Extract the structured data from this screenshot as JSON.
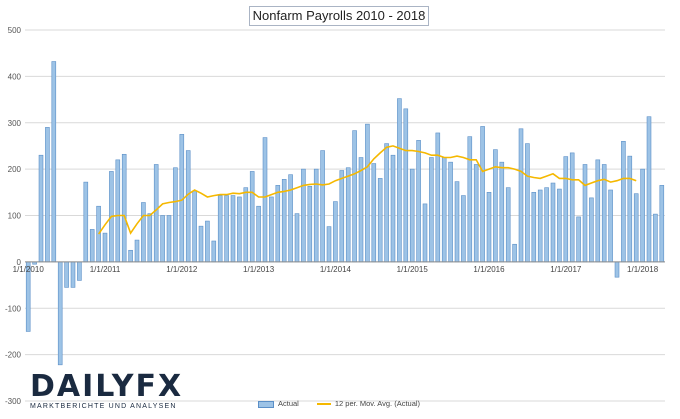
{
  "chart_data": {
    "type": "bar",
    "title": "Nonfarm Payrolls 2010 - 2018",
    "ylim": [
      -300,
      500
    ],
    "yticks": [
      500,
      400,
      300,
      200,
      100,
      0,
      -100,
      -200,
      -300
    ],
    "xtick_labels": [
      {
        "label": "1/1/2010",
        "index": 0
      },
      {
        "label": "1/1/2011",
        "index": 12
      },
      {
        "label": "1/1/2012",
        "index": 24
      },
      {
        "label": "1/1/2013",
        "index": 36
      },
      {
        "label": "1/1/2014",
        "index": 48
      },
      {
        "label": "1/1/2015",
        "index": 60
      },
      {
        "label": "1/1/2016",
        "index": 72
      },
      {
        "label": "1/1/2017",
        "index": 84
      },
      {
        "label": "1/1/2018",
        "index": 96
      }
    ],
    "grid": true,
    "legend_placement": "bottom",
    "series": [
      {
        "name": "Actual",
        "kind": "bar",
        "color": "#9dc3e6",
        "values": [
          -150,
          -5,
          230,
          290,
          432,
          -222,
          -55,
          -55,
          -40,
          172,
          70,
          120,
          62,
          195,
          220,
          232,
          25,
          47,
          128,
          104,
          210,
          100,
          100,
          203,
          275,
          240,
          153,
          77,
          88,
          45,
          143,
          143,
          143,
          140,
          160,
          195,
          120,
          268,
          140,
          165,
          178,
          188,
          104,
          200,
          163,
          200,
          240,
          76,
          130,
          197,
          203,
          283,
          225,
          297,
          212,
          180,
          255,
          230,
          352,
          330,
          200,
          262,
          125,
          225,
          278,
          225,
          215,
          173,
          143,
          270,
          210,
          292,
          150,
          242,
          215,
          160,
          38,
          287,
          255,
          150,
          155,
          160,
          170,
          157,
          227,
          235,
          97,
          210,
          138,
          220,
          210,
          155,
          -33,
          260,
          228,
          147,
          200,
          313,
          103,
          165
        ]
      },
      {
        "name": "12 per. Mov. Avg. (Actual)",
        "kind": "line",
        "color": "#f5b800",
        "start_index": 11,
        "values": [
          60,
          80,
          98,
          100,
          100,
          62,
          82,
          100,
          100,
          112,
          125,
          128,
          130,
          133,
          146,
          155,
          148,
          140,
          143,
          145,
          145,
          148,
          147,
          150,
          150,
          140,
          140,
          145,
          150,
          152,
          155,
          160,
          165,
          167,
          168,
          166,
          168,
          175,
          180,
          185,
          190,
          197,
          205,
          222,
          235,
          247,
          250,
          245,
          240,
          240,
          238,
          235,
          230,
          230,
          225,
          225,
          228,
          225,
          220,
          220,
          195,
          200,
          205,
          203,
          203,
          200,
          195,
          185,
          182,
          180,
          185,
          190,
          180,
          180,
          177,
          177,
          165,
          170,
          175,
          178,
          172,
          175,
          180,
          180,
          175
        ]
      }
    ]
  },
  "logo": {
    "word_left": "DAILY",
    "word_right": "FX",
    "tagline": "MARKTBERICHTE UND ANALYSEN"
  },
  "legend": {
    "actual": "Actual",
    "moving_avg": "12 per. Mov. Avg. (Actual)"
  }
}
